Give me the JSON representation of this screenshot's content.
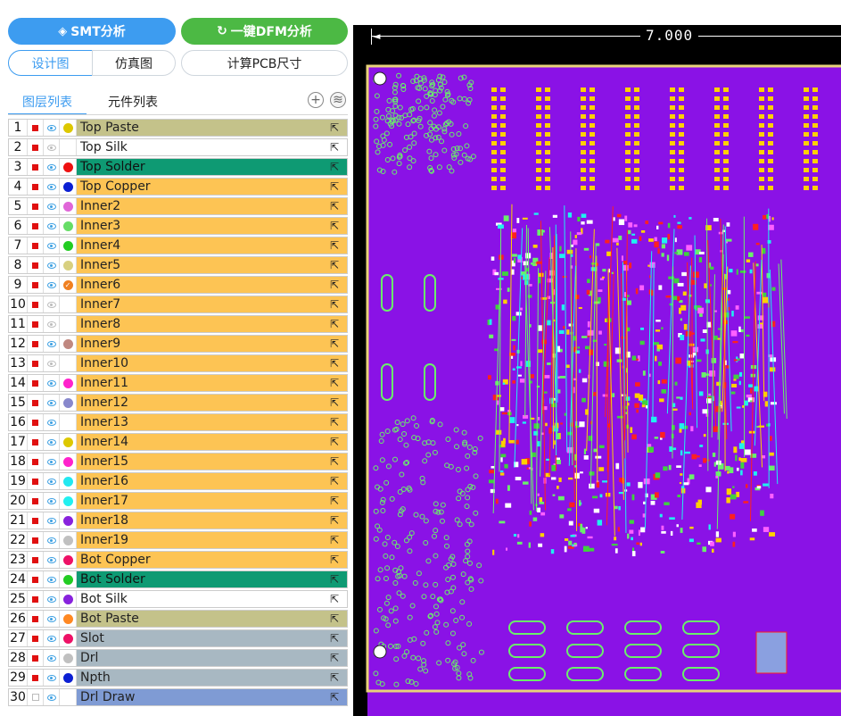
{
  "toolbar": {
    "smt_label": "SMT分析",
    "dfm_label": "一键DFM分析",
    "design_tab": "设计图",
    "sim_tab": "仿真图",
    "calc_button": "计算PCB尺寸"
  },
  "subtabs": {
    "layers": "图层列表",
    "parts": "元件列表"
  },
  "layers": [
    {
      "num": "1",
      "name": "Top Paste",
      "color": "#ddc800",
      "bg": "#c4c28a",
      "red": true,
      "eye": true,
      "check": false
    },
    {
      "num": "2",
      "name": "Top Silk",
      "color": "",
      "bg": "#ffffff",
      "red": true,
      "eye": false,
      "check": false
    },
    {
      "num": "3",
      "name": "Top Solder",
      "color": "#ee1111",
      "bg": "#0e9a73",
      "red": true,
      "eye": true,
      "check": false
    },
    {
      "num": "4",
      "name": "Top Copper",
      "color": "#0b1fd3",
      "bg": "#fdc454",
      "red": true,
      "eye": true,
      "check": false
    },
    {
      "num": "5",
      "name": "Inner2",
      "color": "#e066d8",
      "bg": "#fdc454",
      "red": true,
      "eye": true,
      "check": false
    },
    {
      "num": "6",
      "name": "Inner3",
      "color": "#66dd66",
      "bg": "#fdc454",
      "red": true,
      "eye": true,
      "check": false
    },
    {
      "num": "7",
      "name": "Inner4",
      "color": "#22cc22",
      "bg": "#fdc454",
      "red": true,
      "eye": true,
      "check": false
    },
    {
      "num": "8",
      "name": "Inner5",
      "color": "#d8d080",
      "bg": "#fdc454",
      "red": true,
      "eye": true,
      "check": false
    },
    {
      "num": "9",
      "name": "Inner6",
      "color": "#f08020",
      "bg": "#fdc454",
      "red": true,
      "eye": true,
      "check": true
    },
    {
      "num": "10",
      "name": "Inner7",
      "color": "",
      "bg": "#fdc454",
      "red": true,
      "eye": false,
      "check": false
    },
    {
      "num": "11",
      "name": "Inner8",
      "color": "",
      "bg": "#fdc454",
      "red": true,
      "eye": false,
      "check": false
    },
    {
      "num": "12",
      "name": "Inner9",
      "color": "#c08880",
      "bg": "#fdc454",
      "red": true,
      "eye": true,
      "check": false
    },
    {
      "num": "13",
      "name": "Inner10",
      "color": "",
      "bg": "#fdc454",
      "red": true,
      "eye": false,
      "check": false
    },
    {
      "num": "14",
      "name": "Inner11",
      "color": "#ff22cc",
      "bg": "#fdc454",
      "red": true,
      "eye": true,
      "check": false
    },
    {
      "num": "15",
      "name": "Inner12",
      "color": "#8888cc",
      "bg": "#fdc454",
      "red": true,
      "eye": true,
      "check": false
    },
    {
      "num": "16",
      "name": "Inner13",
      "color": "",
      "bg": "#fdc454",
      "red": true,
      "eye": true,
      "check": false
    },
    {
      "num": "17",
      "name": "Inner14",
      "color": "#ddc800",
      "bg": "#fdc454",
      "red": true,
      "eye": true,
      "check": false
    },
    {
      "num": "18",
      "name": "Inner15",
      "color": "#ff22cc",
      "bg": "#fdc454",
      "red": true,
      "eye": true,
      "check": false
    },
    {
      "num": "19",
      "name": "Inner16",
      "color": "#22e8f0",
      "bg": "#fdc454",
      "red": true,
      "eye": true,
      "check": false
    },
    {
      "num": "20",
      "name": "Inner17",
      "color": "#22f0f0",
      "bg": "#fdc454",
      "red": true,
      "eye": true,
      "check": false
    },
    {
      "num": "21",
      "name": "Inner18",
      "color": "#8822dd",
      "bg": "#fdc454",
      "red": true,
      "eye": true,
      "check": false
    },
    {
      "num": "22",
      "name": "Inner19",
      "color": "#c0c0c0",
      "bg": "#fdc454",
      "red": true,
      "eye": true,
      "check": false
    },
    {
      "num": "23",
      "name": "Bot Copper",
      "color": "#ee1166",
      "bg": "#fdc454",
      "red": true,
      "eye": true,
      "check": false
    },
    {
      "num": "24",
      "name": "Bot Solder",
      "color": "#22cc22",
      "bg": "#0e9a73",
      "red": true,
      "eye": true,
      "check": false
    },
    {
      "num": "25",
      "name": "Bot Silk",
      "color": "#8822dd",
      "bg": "#ffffff",
      "red": true,
      "eye": true,
      "check": false
    },
    {
      "num": "26",
      "name": "Bot Paste",
      "color": "#ff8822",
      "bg": "#c4c28a",
      "red": true,
      "eye": true,
      "check": false
    },
    {
      "num": "27",
      "name": "Slot",
      "color": "#ee1166",
      "bg": "#a8b8c2",
      "red": true,
      "eye": true,
      "check": false
    },
    {
      "num": "28",
      "name": "Drl",
      "color": "#c0c0c0",
      "bg": "#a8b8c2",
      "red": true,
      "eye": true,
      "check": false
    },
    {
      "num": "29",
      "name": "Npth",
      "color": "#0b1fd3",
      "bg": "#a8b8c2",
      "red": true,
      "eye": true,
      "check": false
    },
    {
      "num": "30",
      "name": "Drl Draw",
      "color": "",
      "bg": "#7f9bd4",
      "red": false,
      "eye": true,
      "check": false
    }
  ],
  "canvas": {
    "dimension_label": "7.000",
    "board_bg": "#8a12e6",
    "outline_color": "#e8d27a"
  }
}
